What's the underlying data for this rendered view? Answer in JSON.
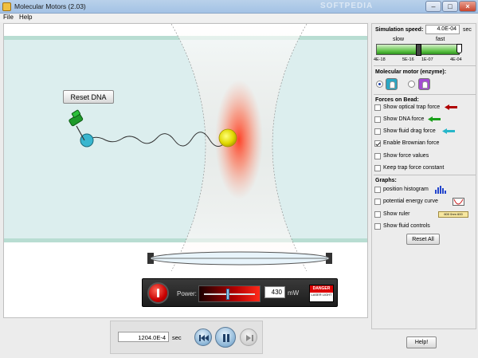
{
  "window": {
    "title": "Molecular Motors (2.03)",
    "watermark": "SOFTPEDIA",
    "min_icon": "minimize-icon",
    "max_icon": "maximize-icon",
    "close_icon": "close-icon"
  },
  "menu": {
    "file": "File",
    "help": "Help"
  },
  "sim": {
    "reset_dna_label": "Reset DNA",
    "laser": {
      "power_label": "Power:",
      "power_value": "430",
      "power_unit": "mW",
      "power_fraction": 0.43,
      "danger_title": "DANGER",
      "danger_text": "LASER LIGHT"
    }
  },
  "controls": {
    "speed": {
      "label": "Simulation speed:",
      "value": "4.0E-04",
      "unit": "sec",
      "slow_label": "slow",
      "fast_label": "fast",
      "ticks": [
        "4E-18",
        "5E-16",
        "1E-07",
        "4E-04"
      ],
      "position_fraction": 0.5
    },
    "motor": {
      "label": "Molecular motor (enzyme):",
      "options": [
        {
          "id": "enzyme-a",
          "color": "#2aa7c4",
          "selected": true
        },
        {
          "id": "enzyme-b",
          "color": "#a34bd2",
          "selected": false
        }
      ]
    },
    "forces_title": "Forces on Bead:",
    "forces": [
      {
        "label": "Show optical trap force",
        "checked": false,
        "icon": "optical-trap-arrow-icon",
        "color": "#b00000"
      },
      {
        "label": "Show DNA force",
        "checked": false,
        "icon": "dna-force-arrow-icon",
        "color": "#1aa01a"
      },
      {
        "label": "Show fluid drag force",
        "checked": false,
        "icon": "fluid-drag-arrow-icon",
        "color": "#27b6c9"
      }
    ],
    "brownian": {
      "label": "Enable Brownian force",
      "checked": true
    },
    "force_values": {
      "label": "Show force values",
      "checked": false
    },
    "trap_constant": {
      "label": "Keep trap force constant",
      "checked": false
    },
    "graphs_title": "Graphs:",
    "graphs": [
      {
        "label": "position histogram",
        "checked": false,
        "icon": "histogram-icon"
      },
      {
        "label": "potential energy curve",
        "checked": false,
        "icon": "energy-curve-icon"
      }
    ],
    "ruler": {
      "label": "Show ruler",
      "checked": false,
      "icon": "ruler-icon",
      "ticks": "600 0nm 600"
    },
    "fluid": {
      "label": "Show fluid controls",
      "checked": false
    },
    "reset_all_label": "Reset All"
  },
  "clock": {
    "time": "1204.0E-4",
    "unit": "sec",
    "buttons": [
      {
        "name": "restart-button",
        "icon": "restart-icon"
      },
      {
        "name": "pause-button",
        "icon": "pause-icon"
      },
      {
        "name": "step-button",
        "icon": "step-icon",
        "disabled": true
      }
    ]
  },
  "help_label": "Help!"
}
